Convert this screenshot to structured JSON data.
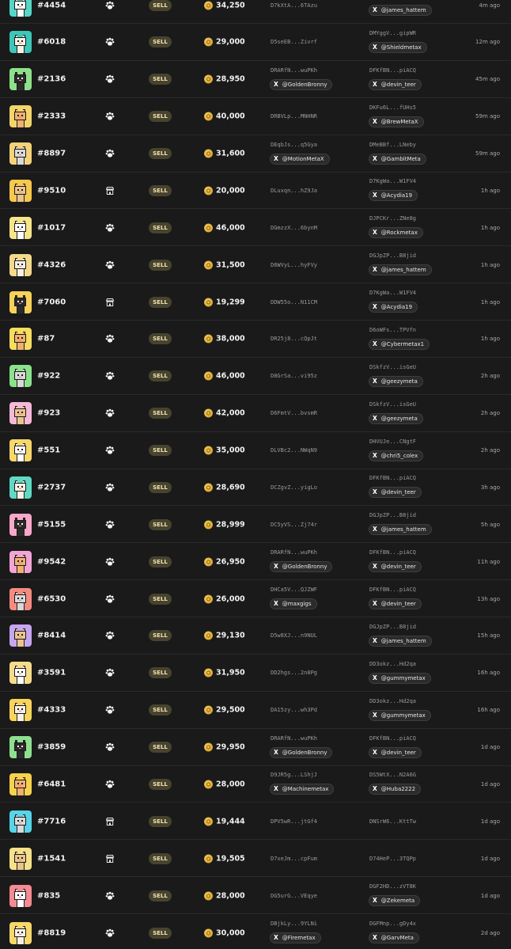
{
  "icons": {
    "market_paw": "paw-icon",
    "market_store": "store-icon",
    "currency": "coin-icon",
    "social": "x-icon"
  },
  "social_glyph": "X",
  "rows": [
    {
      "id": "#4454",
      "market": "paw",
      "bg": "#55d6c6",
      "type": "SELL",
      "price": "34,250",
      "seller": "D7kXtA...6TAzu",
      "seller_tw": null,
      "buyer": "DGJpZP...B8jid",
      "buyer_tw": "@james_hattem",
      "time": "4m ago"
    },
    {
      "id": "#6018",
      "market": "paw",
      "bg": "#3cc7b8",
      "type": "SELL",
      "price": "29,000",
      "seller": "D5seEB...Zivrf",
      "seller_tw": null,
      "buyer": "DMYggV...gipWR",
      "buyer_tw": "@Shieldmetax",
      "time": "12m ago"
    },
    {
      "id": "#2136",
      "market": "paw",
      "bg": "#8fe08a",
      "type": "SELL",
      "price": "28,950",
      "seller": "DRARfN...wuPKh",
      "seller_tw": "@GoldenBronny",
      "buyer": "DFKfBN...piACQ",
      "buyer_tw": "@devin_teer",
      "time": "45m ago"
    },
    {
      "id": "#2333",
      "market": "paw",
      "bg": "#f3d469",
      "type": "SELL",
      "price": "40,000",
      "seller": "DRBVLp...MNHNR",
      "seller_tw": null,
      "buyer": "DKFu6L...fUHs5",
      "buyer_tw": "@BrewMetaX",
      "time": "59m ago"
    },
    {
      "id": "#8897",
      "market": "paw",
      "bg": "#f4d27a",
      "type": "SELL",
      "price": "31,600",
      "seller": "DEqbJs...q5Gya",
      "seller_tw": "@MotionMetaX",
      "buyer": "DMeBBf...LNeby",
      "buyer_tw": "@GambitMeta",
      "time": "59m ago"
    },
    {
      "id": "#9510",
      "market": "store",
      "bg": "#f6c84d",
      "type": "SELL",
      "price": "20,000",
      "seller": "DLuxqn...hZ9Ja",
      "seller_tw": null,
      "buyer": "D7KgWa...W1FV4",
      "buyer_tw": "@Acydia19",
      "time": "1h ago"
    },
    {
      "id": "#1017",
      "market": "paw",
      "bg": "#f6e58a",
      "type": "SELL",
      "price": "46,000",
      "seller": "DGmzzX...6bynM",
      "seller_tw": null,
      "buyer": "DJPCKr...ZNe8g",
      "buyer_tw": "@Rockmetax",
      "time": "1h ago"
    },
    {
      "id": "#4326",
      "market": "paw",
      "bg": "#f4d98a",
      "type": "SELL",
      "price": "31,500",
      "seller": "D6WVyL...hyFVy",
      "seller_tw": null,
      "buyer": "DGJpZP...B8jid",
      "buyer_tw": "@james_hattem",
      "time": "1h ago"
    },
    {
      "id": "#7060",
      "market": "store",
      "bg": "#f6d25a",
      "type": "SELL",
      "price": "19,299",
      "seller": "DDW55o...N11CM",
      "seller_tw": null,
      "buyer": "D7KgWa...W1FV4",
      "buyer_tw": "@Acydia19",
      "time": "1h ago"
    },
    {
      "id": "#87",
      "market": "paw",
      "bg": "#f7dc5e",
      "type": "SELL",
      "price": "38,000",
      "seller": "DR25j8...cQpJt",
      "seller_tw": null,
      "buyer": "D6oWFs...TPVfn",
      "buyer_tw": "@Cybermetax1",
      "time": "1h ago"
    },
    {
      "id": "#922",
      "market": "paw",
      "bg": "#8be28a",
      "type": "SELL",
      "price": "46,000",
      "seller": "D8GrSa...vi95z",
      "seller_tw": null,
      "buyer": "DSkfzV...isGeU",
      "buyer_tw": "@geezymeta",
      "time": "2h ago"
    },
    {
      "id": "#923",
      "market": "paw",
      "bg": "#f6b8d8",
      "type": "SELL",
      "price": "42,000",
      "seller": "D6FmtV...bvsmR",
      "seller_tw": null,
      "buyer": "DSkfzV...isGeU",
      "buyer_tw": "@geezymeta",
      "time": "2h ago"
    },
    {
      "id": "#551",
      "market": "paw",
      "bg": "#f6d76a",
      "type": "SELL",
      "price": "35,000",
      "seller": "DLVBc2...NWqN9",
      "seller_tw": null,
      "buyer": "DHVUJe...CNgtF",
      "buyer_tw": "@chri5_colex",
      "time": "2h ago"
    },
    {
      "id": "#2737",
      "market": "paw",
      "bg": "#5fd9c4",
      "type": "SELL",
      "price": "28,690",
      "seller": "DCZgvZ...yigLo",
      "seller_tw": null,
      "buyer": "DFKfBN...piACQ",
      "buyer_tw": "@devin_teer",
      "time": "3h ago"
    },
    {
      "id": "#5155",
      "market": "paw",
      "bg": "#f7a8c9",
      "type": "SELL",
      "price": "28,999",
      "seller": "DC5yVS...Zj74r",
      "seller_tw": null,
      "buyer": "DGJpZP...B8jid",
      "buyer_tw": "@james_hattem",
      "time": "5h ago"
    },
    {
      "id": "#9542",
      "market": "paw",
      "bg": "#f2a4d6",
      "type": "SELL",
      "price": "26,950",
      "seller": "DRARfN...wuPKh",
      "seller_tw": "@GoldenBronny",
      "buyer": "DFKfBN...piACQ",
      "buyer_tw": "@devin_teer",
      "time": "11h ago"
    },
    {
      "id": "#6530",
      "market": "paw",
      "bg": "#f58b80",
      "type": "SELL",
      "price": "26,000",
      "seller": "DHCa5V...QJZWF",
      "seller_tw": "@maxgigs",
      "buyer": "DFKfBN...piACQ",
      "buyer_tw": "@devin_teer",
      "time": "13h ago"
    },
    {
      "id": "#8414",
      "market": "paw",
      "bg": "#c7a6f0",
      "type": "SELL",
      "price": "29,130",
      "seller": "D5w8XJ...n9NUL",
      "seller_tw": null,
      "buyer": "DGJpZP...B8jid",
      "buyer_tw": "@james_hattem",
      "time": "15h ago"
    },
    {
      "id": "#3591",
      "market": "paw",
      "bg": "#f6dc8a",
      "type": "SELL",
      "price": "31,950",
      "seller": "DD2hgs...2n8Pg",
      "seller_tw": null,
      "buyer": "DD3okz...Hd2qa",
      "buyer_tw": "@gummymetax",
      "time": "16h ago"
    },
    {
      "id": "#4333",
      "market": "paw",
      "bg": "#f7d45a",
      "type": "SELL",
      "price": "29,500",
      "seller": "DA15zy...wh3Pd",
      "seller_tw": null,
      "buyer": "DD3okz...Hd2qa",
      "buyer_tw": "@gummymetax",
      "time": "16h ago"
    },
    {
      "id": "#3859",
      "market": "paw",
      "bg": "#8ee08f",
      "type": "SELL",
      "price": "29,950",
      "seller": "DRARfN...wuPKh",
      "seller_tw": "@GoldenBronny",
      "buyer": "DFKfBN...piACQ",
      "buyer_tw": "@devin_teer",
      "time": "1d ago"
    },
    {
      "id": "#6481",
      "market": "paw",
      "bg": "#f6d24c",
      "type": "SELL",
      "price": "28,000",
      "seller": "D9JR5g...LShjJ",
      "seller_tw": "@Machinemetax",
      "buyer": "DS5WtX...N2A6G",
      "buyer_tw": "@Huba2222",
      "time": "1d ago"
    },
    {
      "id": "#7716",
      "market": "store",
      "bg": "#58d4e8",
      "type": "SELL",
      "price": "19,444",
      "seller": "DPV5wR...jtGf4",
      "seller_tw": null,
      "buyer": "DNSrW6...KttTw",
      "buyer_tw": null,
      "time": "1d ago"
    },
    {
      "id": "#1541",
      "market": "store",
      "bg": "#f6e08a",
      "type": "SELL",
      "price": "19,505",
      "seller": "D7xeJm...cpFum",
      "seller_tw": null,
      "buyer": "D74HeP...3TQPp",
      "buyer_tw": null,
      "time": "1d ago"
    },
    {
      "id": "#835",
      "market": "paw",
      "bg": "#f48a92",
      "type": "SELL",
      "price": "28,000",
      "seller": "DG5urG...VEqye",
      "seller_tw": null,
      "buyer": "DGF2HD...zVT8K",
      "buyer_tw": "@Zekemeta",
      "time": "1d ago"
    },
    {
      "id": "#8819",
      "market": "paw",
      "bg": "#f6d76a",
      "type": "SELL",
      "price": "30,000",
      "seller": "DBjkLy...9YLNi",
      "seller_tw": "@Firemetax",
      "buyer": "DGFMnp...gDy4x",
      "buyer_tw": "@GarvMeta",
      "time": "2d ago"
    }
  ]
}
